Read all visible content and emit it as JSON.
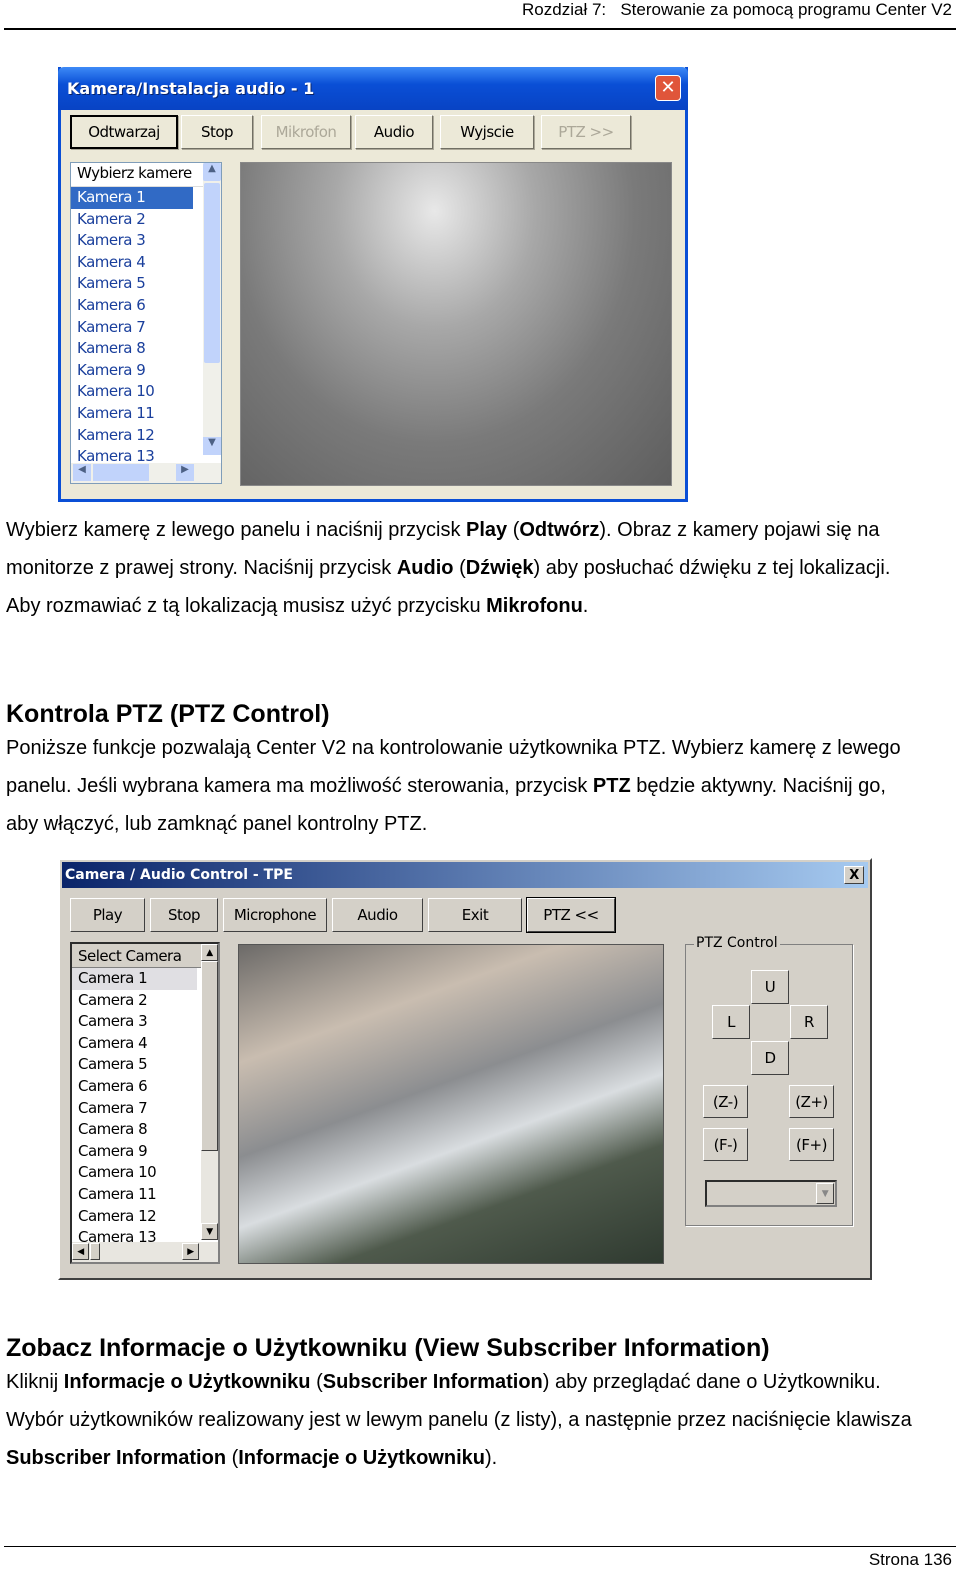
{
  "header": {
    "chapter": "Rozdział 7:",
    "title": "Sterowanie za pomocą programu Center V2"
  },
  "window1": {
    "title": "Kamera/Instalacja audio - 1",
    "buttons": [
      "Odtwarzaj",
      "Stop",
      "Mikrofon",
      "Audio",
      "Wyjscie",
      "PTZ  >>"
    ],
    "disabled": [
      false,
      false,
      true,
      false,
      false,
      true
    ],
    "list_header": "Wybierz kamere",
    "cameras": [
      "Kamera 1",
      "Kamera 2",
      "Kamera 3",
      "Kamera 4",
      "Kamera 5",
      "Kamera 6",
      "Kamera 7",
      "Kamera 8",
      "Kamera 9",
      "Kamera 10",
      "Kamera 11",
      "Kamera 12",
      "Kamera 13"
    ],
    "selected": "Kamera 1",
    "title_color": "#0a4fd6",
    "selection_color": "#316ac5"
  },
  "para1": [
    [
      {
        "t": "Wybierz kamerę z lewego panelu i naciśnij przycisk "
      },
      {
        "t": "Play",
        "b": true
      },
      {
        "t": " ("
      },
      {
        "t": "Odtwórz",
        "b": true
      },
      {
        "t": "). Obraz z kamery pojawi się na"
      }
    ],
    [
      {
        "t": "monitorze z prawej strony. Naciśnij przycisk "
      },
      {
        "t": "Audio",
        "b": true
      },
      {
        "t": " ("
      },
      {
        "t": "Dźwięk",
        "b": true
      },
      {
        "t": ") aby posłuchać dźwięku z tej lokalizacji."
      }
    ],
    [
      {
        "t": "Aby rozmawiać z tą lokalizacją musisz użyć przycisku "
      },
      {
        "t": "Mikrofonu",
        "b": true
      },
      {
        "t": "."
      }
    ]
  ],
  "heading1": "Kontrola PTZ (PTZ Control)",
  "para2": [
    [
      {
        "t": "Poniższe funkcje pozwalają Center V2 na kontrolowanie użytkownika PTZ. Wybierz kamerę z lewego"
      }
    ],
    [
      {
        "t": "panelu. Jeśli wybrana kamera ma możliwość sterowania, przycisk "
      },
      {
        "t": "PTZ",
        "b": true
      },
      {
        "t": " będzie aktywny. Naciśnij go,"
      }
    ],
    [
      {
        "t": "aby włączyć, lub zamknąć panel kontrolny PTZ."
      }
    ]
  ],
  "window2": {
    "title": "Camera / Audio Control - TPE",
    "close": "X",
    "buttons": [
      "Play",
      "Stop",
      "Microphone",
      "Audio",
      "Exit",
      "PTZ  <<"
    ],
    "list_header": "Select Camera",
    "cameras": [
      "Camera 1",
      "Camera 2",
      "Camera 3",
      "Camera 4",
      "Camera 5",
      "Camera 6",
      "Camera 7",
      "Camera 8",
      "Camera 9",
      "Camera 10",
      "Camera 11",
      "Camera 12",
      "Camera 13"
    ],
    "ptz": {
      "label": "PTZ Control",
      "up": "U",
      "left": "L",
      "right": "R",
      "down": "D",
      "zoom_out": "(Z-)",
      "zoom_in": "(Z+)",
      "focus_out": "(F-)",
      "focus_in": "(F+)",
      "preset_value": ""
    },
    "title_color": "#0a246a"
  },
  "heading2": "Zobacz Informacje o Użytkowniku (View Subscriber Information)",
  "para3": [
    [
      {
        "t": "Kliknij "
      },
      {
        "t": "Informacje o Użytkowniku",
        "b": true
      },
      {
        "t": " ("
      },
      {
        "t": "Subscriber Information",
        "b": true
      },
      {
        "t": ") aby przeglądać dane o Użytkowniku."
      }
    ],
    [
      {
        "t": "Wybór użytkowników realizowany jest w lewym panelu (z listy), a następnie przez naciśnięcie klawisza"
      }
    ],
    [
      {
        "t": "Subscriber Information",
        "b": true
      },
      {
        "t": " ("
      },
      {
        "t": "Informacje o Użytkowniku",
        "b": true
      },
      {
        "t": ")."
      }
    ]
  ],
  "footer": {
    "page": "Strona 136"
  }
}
